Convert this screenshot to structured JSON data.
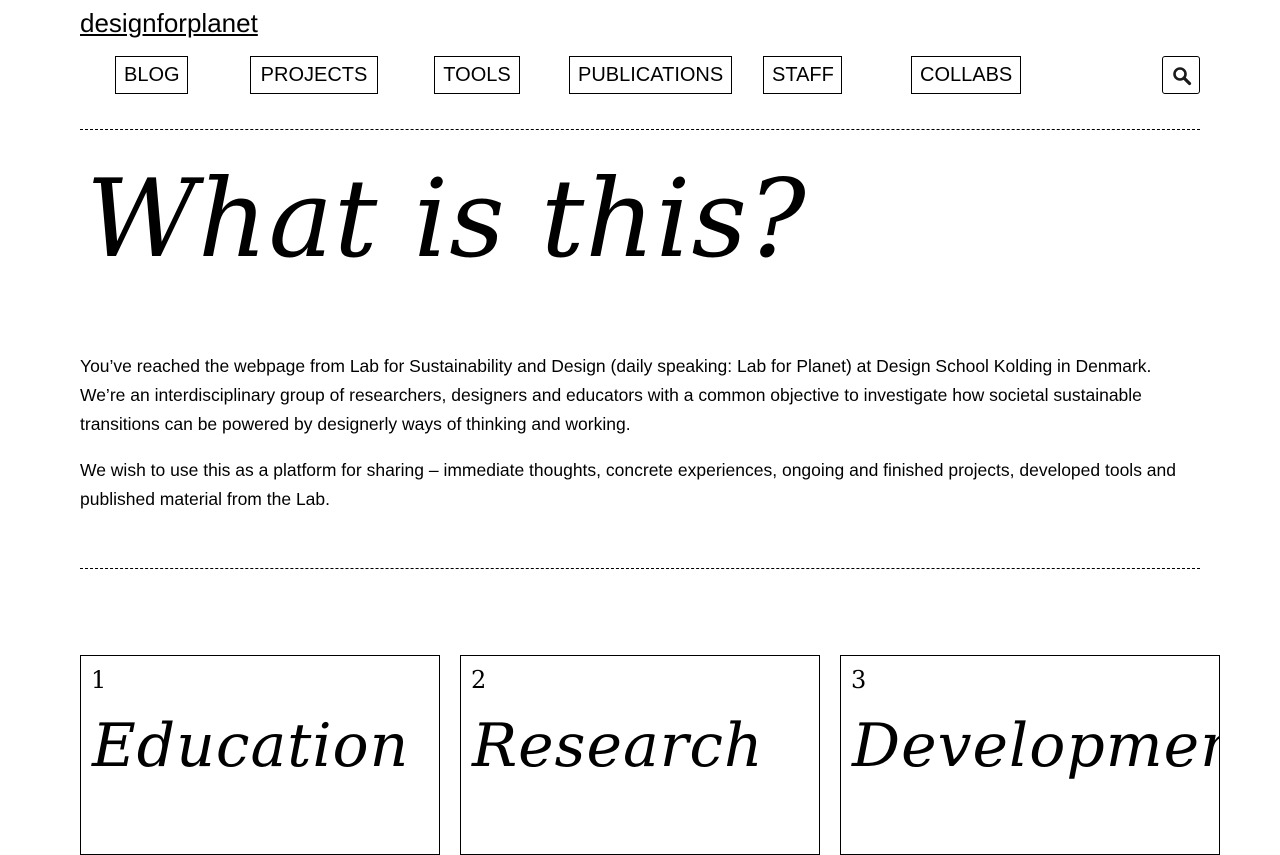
{
  "header": {
    "logo": "designforplanet",
    "nav": [
      "BLOG",
      "PROJECTS",
      "TOOLS",
      "PUBLICATIONS",
      "STAFF",
      "COLLABS"
    ],
    "search_icon": "search-icon"
  },
  "hero": {
    "title": "What is this?"
  },
  "intro": {
    "paragraphs": [
      "You’ve reached the webpage from Lab for Sustainability and Design (daily speaking: Lab for Planet) at Design School Kolding in Denmark. We’re an interdisciplinary group of researchers, designers and educators with a common objective to investigate how societal sustainable transitions can be powered by designerly ways of thinking and working.",
      "We wish to use this as a platform for sharing – immediate thoughts, concrete experiences, ongoing and finished projects, developed tools and published material from the Lab."
    ]
  },
  "cards": [
    {
      "number": "1",
      "title": "Education"
    },
    {
      "number": "2",
      "title": "Research"
    },
    {
      "number": "3",
      "title": "Development"
    }
  ]
}
